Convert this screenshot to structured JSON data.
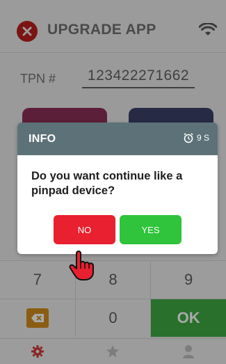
{
  "header": {
    "title": "UPGRADE APP",
    "close_icon": "close-icon",
    "wifi_icon": "wifi-icon"
  },
  "form": {
    "tpn_label": "TPN #",
    "tpn_value": "123422271662"
  },
  "keypad": {
    "row1": [
      "7",
      "8",
      "9"
    ],
    "row2": {
      "backspace_icon": "backspace-icon",
      "zero": "0",
      "ok": "OK"
    }
  },
  "tabs": [
    "gear-icon",
    "star-icon",
    "user-icon"
  ],
  "dialog": {
    "title": "INFO",
    "timer": "9 S",
    "message": "Do you want continue like a pinpad device?",
    "no_label": "NO",
    "yes_label": "YES"
  },
  "colors": {
    "close_red": "#e8202f",
    "no_red": "#e8202f",
    "yes_green": "#2fc43b",
    "ok_green": "#28702b",
    "dialog_header": "#5d7278"
  }
}
